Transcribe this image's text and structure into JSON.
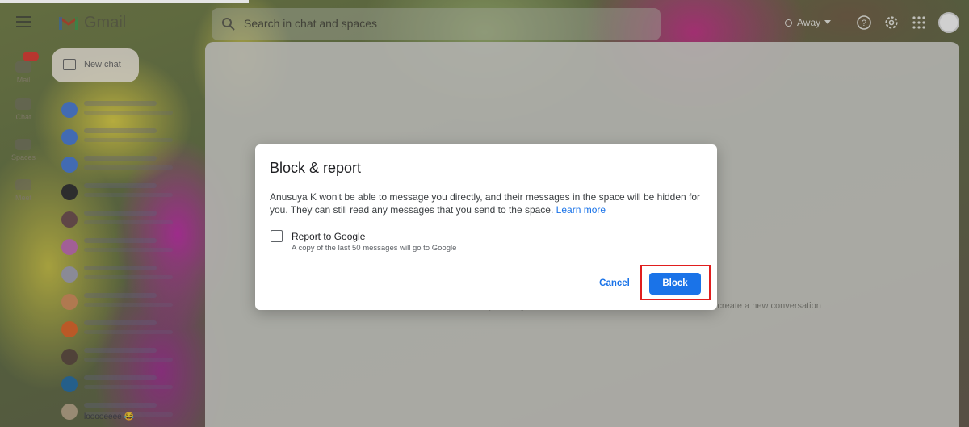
{
  "app": {
    "title": "Gmail"
  },
  "search": {
    "placeholder": "Search in chat and spaces"
  },
  "topbar": {
    "status": "Away"
  },
  "rail": {
    "items": [
      "Mail",
      "Chat",
      "Spaces",
      "Meet"
    ]
  },
  "sidebar": {
    "new_chat_label": "New chat",
    "last_preview": "looooeeee 😂"
  },
  "main": {
    "hint": "Start a chat by clicking one of the chats on the left or click 'New chat' to create a new conversation"
  },
  "dialog": {
    "title": "Block & report",
    "message": "Anusuya K won't be able to message you directly, and their messages in the space will be hidden for you. They can still read any messages that you send to the space.",
    "learn_more": "Learn more",
    "report_label": "Report to Google",
    "report_sub": "A copy of the last 50 messages will go to Google",
    "report_checked": false,
    "cancel_label": "Cancel",
    "block_label": "Block"
  },
  "colors": {
    "accent": "#1a73e8",
    "highlight": "#e01e1e"
  }
}
